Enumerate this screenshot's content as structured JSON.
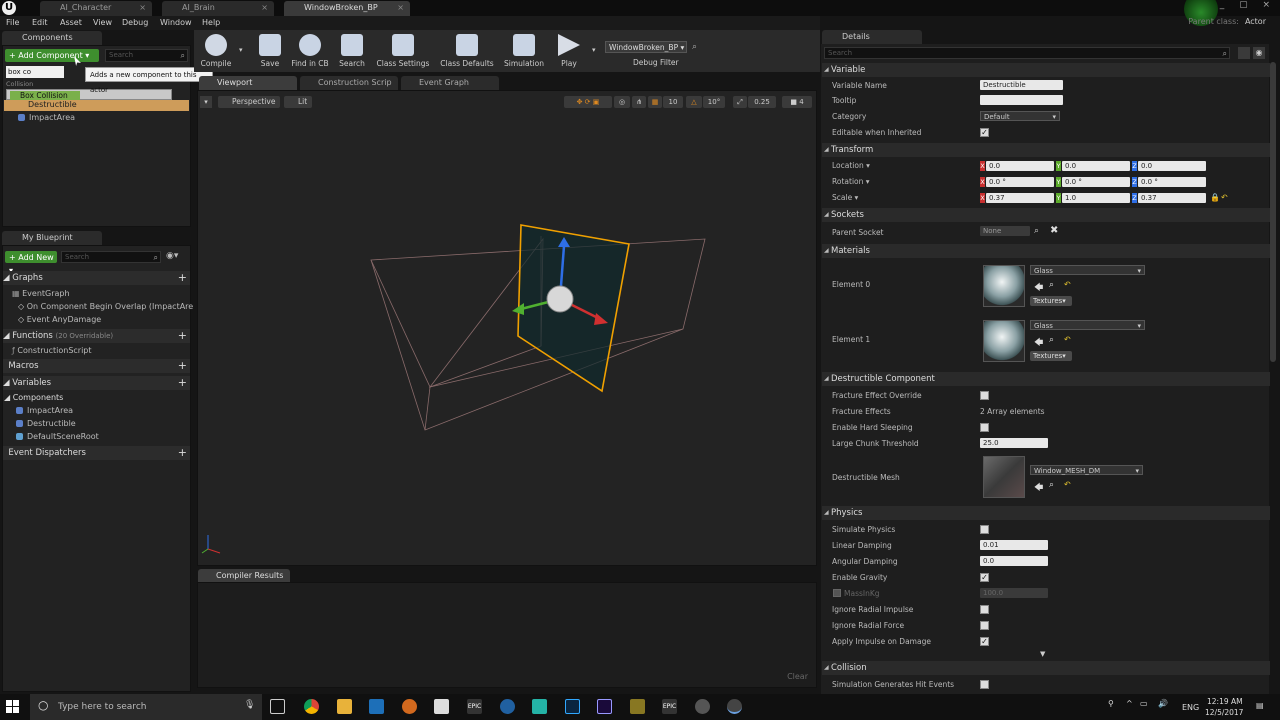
{
  "titlebar": {
    "tabs": [
      "AI_Character",
      "AI_Brain",
      "WindowBroken_BP"
    ],
    "parent_class_label": "Parent class:",
    "parent_class_value": "Actor"
  },
  "menu": [
    "File",
    "Edit",
    "Asset",
    "View",
    "Debug",
    "Window",
    "Help"
  ],
  "components": {
    "header": "Components",
    "add_label": "+ Add Component",
    "search_placeholder": "Search",
    "tooltip": "Adds a new component to this actor",
    "filter_value": "box co",
    "category": "Collision",
    "suggestion": "Box Collision",
    "items": [
      "Destructible",
      "ImpactArea"
    ]
  },
  "toolbar": {
    "buttons": [
      "Compile",
      "Save",
      "Find in CB",
      "Search",
      "Class Settings",
      "Class Defaults",
      "Simulation",
      "Play"
    ],
    "debug_object": "WindowBroken_BP",
    "debug_filter": "Debug Filter"
  },
  "mybp": {
    "header": "My Blueprint",
    "add_label": "+ Add New",
    "search_placeholder": "Search",
    "graphs": "Graphs",
    "event_graph": "EventGraph",
    "event1": "On Component Begin Overlap (ImpactAre",
    "event2": "Event AnyDamage",
    "functions": "Functions",
    "functions_count": "(20 Overridable)",
    "construction": "ConstructionScript",
    "macros": "Macros",
    "variables": "Variables",
    "components_cat": "Components",
    "var1": "ImpactArea",
    "var2": "Destructible",
    "var3": "DefaultSceneRoot",
    "dispatchers": "Event Dispatchers"
  },
  "viewport": {
    "tabs": [
      "Viewport",
      "Construction Scrip",
      "Event Graph"
    ],
    "perspective": "Perspective",
    "lit": "Lit",
    "grid": "10",
    "rot": "10°",
    "scale": "0.25",
    "cam": "4"
  },
  "compiler": {
    "header": "Compiler Results",
    "clear": "Clear"
  },
  "details": {
    "header": "Details",
    "search_placeholder": "Search",
    "variable_sec": "Variable",
    "var_name_lbl": "Variable Name",
    "var_name": "Destructible",
    "tooltip_lbl": "Tooltip",
    "category_lbl": "Category",
    "category": "Default",
    "editable_lbl": "Editable when Inherited",
    "transform_sec": "Transform",
    "location_lbl": "Location ▾",
    "rotation_lbl": "Rotation ▾",
    "scale_lbl": "Scale ▾",
    "loc": [
      "0.0",
      "0.0",
      "0.0"
    ],
    "rot": [
      "0.0 °",
      "0.0 °",
      "0.0 °"
    ],
    "scl": [
      "0.37",
      "1.0",
      "0.37"
    ],
    "sockets_sec": "Sockets",
    "parent_socket_lbl": "Parent Socket",
    "parent_socket": "None",
    "materials_sec": "Materials",
    "el0": "Element 0",
    "el1": "Element 1",
    "mat": "Glass",
    "textures": "Textures▾",
    "destr_sec": "Destructible Component",
    "fracture_override": "Fracture Effect Override",
    "fracture_effects": "Fracture Effects",
    "array_elems": "2 Array elements",
    "hard_sleep": "Enable Hard Sleeping",
    "chunk_lbl": "Large Chunk Threshold",
    "chunk": "25.0",
    "dmesh_lbl": "Destructible Mesh",
    "dmesh": "Window_MESH_DM",
    "physics_sec": "Physics",
    "sim_phys": "Simulate Physics",
    "lin_damp_lbl": "Linear Damping",
    "lin_damp": "0.01",
    "ang_damp_lbl": "Angular Damping",
    "ang_damp": "0.0",
    "gravity": "Enable Gravity",
    "mass_lbl": "MassInKg",
    "mass": "100.0",
    "ign_imp": "Ignore Radial Impulse",
    "ign_force": "Ignore Radial Force",
    "apply_imp": "Apply Impulse on Damage",
    "collision_sec": "Collision",
    "sim_hits": "Simulation Generates Hit Events"
  },
  "taskbar": {
    "search_placeholder": "Type here to search",
    "lang": "ENG",
    "time": "12:19 AM",
    "date": "12/5/2017"
  }
}
